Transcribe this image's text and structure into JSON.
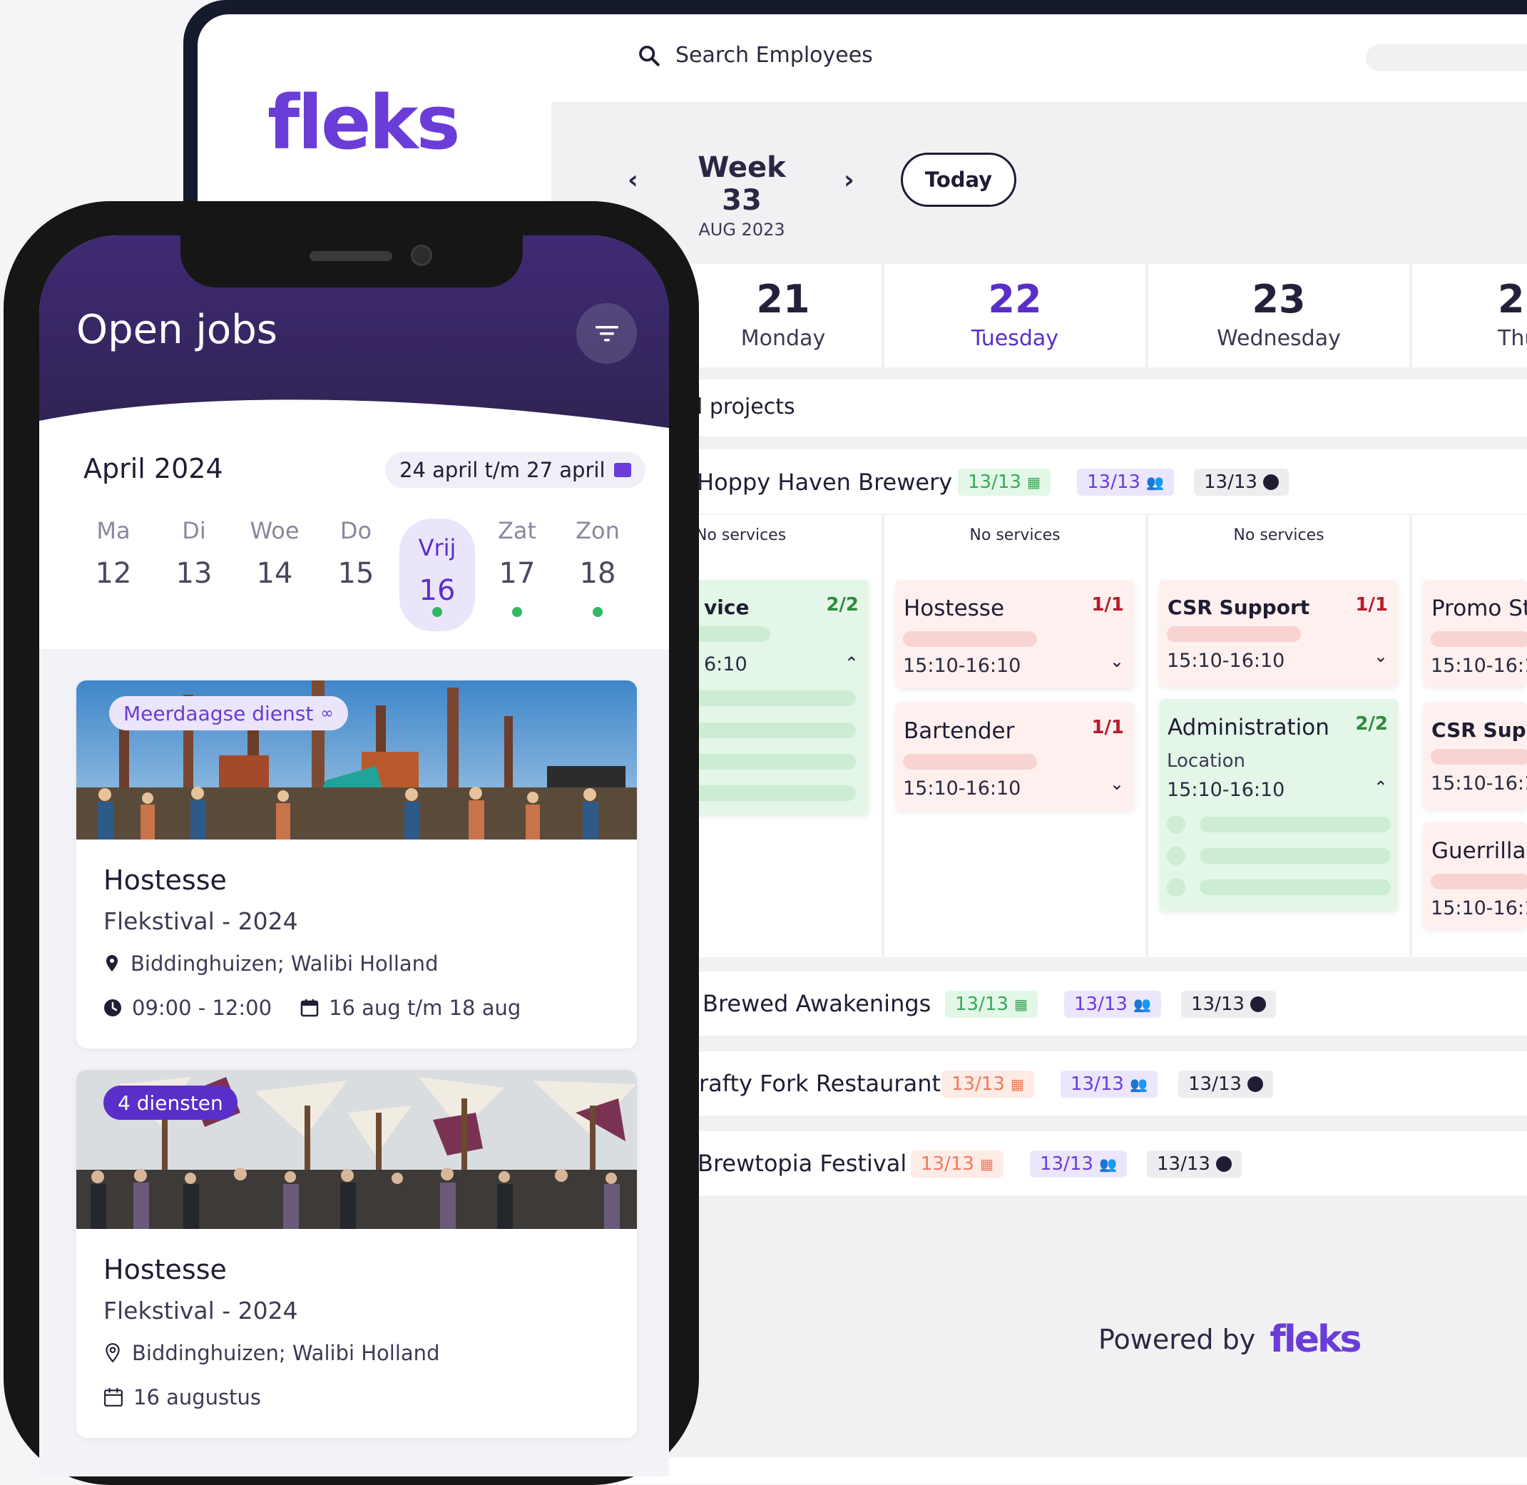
{
  "desktop": {
    "search_placeholder": "Search Employees",
    "logo_text": "fleks",
    "week_title": "Week 33",
    "week_subtitle": "AUG 2023",
    "prev_icon": "chevron-left-icon",
    "next_icon": "chevron-right-icon",
    "today_label": "Today",
    "days": [
      {
        "num": "21",
        "name": "Monday"
      },
      {
        "num": "22",
        "name": "Tuesday"
      },
      {
        "num": "23",
        "name": "Wednesday"
      },
      {
        "num": "2",
        "name": "Thu"
      }
    ],
    "section_label": "l projects",
    "no_services": "No services",
    "projects": [
      {
        "name": "Hoppy Haven Brewery",
        "b1": "13/13",
        "b2": "13/13",
        "b3": "13/13"
      },
      {
        "name": "Brewed Awakenings",
        "b1": "13/13",
        "b2": "13/13",
        "b3": "13/13"
      },
      {
        "name": "rafty Fork Restaurant",
        "b1": "13/13",
        "b2": "13/13",
        "b3": "13/13"
      },
      {
        "name": "Brewtopia Festival",
        "b1": "13/13",
        "b2": "13/13",
        "b3": "13/13"
      }
    ],
    "cards": {
      "mon": {
        "title": "vice",
        "frac": "2/2",
        "time": "6:10"
      },
      "tue1": {
        "title": "Hostesse",
        "frac": "1/1",
        "time": "15:10-16:10"
      },
      "tue2": {
        "title": "Bartender",
        "frac": "1/1",
        "time": "15:10-16:10"
      },
      "wed1": {
        "title": "CSR Support",
        "frac": "1/1",
        "time": "15:10-16:10"
      },
      "wed2": {
        "title": "Administration",
        "frac": "2/2",
        "location": "Location",
        "time": "15:10-16:10"
      },
      "thu1": {
        "title": "Promo St",
        "time": "15:10-16:1"
      },
      "thu2": {
        "title": "CSR Suppo",
        "time": "15:10-16:1"
      },
      "thu3": {
        "title": "Guerrilla",
        "time": "15:10-16:1"
      }
    },
    "powered_by": "Powered by",
    "powered_logo": "fleks"
  },
  "phone": {
    "header_title": "Open jobs",
    "filter_icon": "filter-icon",
    "month": "April 2024",
    "range": "24 april t/m 27 april",
    "weekdays": [
      {
        "label": "Ma",
        "day": "12"
      },
      {
        "label": "Di",
        "day": "13"
      },
      {
        "label": "Woe",
        "day": "14"
      },
      {
        "label": "Do",
        "day": "15"
      },
      {
        "label": "Vrij",
        "day": "16"
      },
      {
        "label": "Zat",
        "day": "17"
      },
      {
        "label": "Zon",
        "day": "18"
      }
    ],
    "jobs": [
      {
        "badge": "Meerdaagse dienst",
        "title": "Hostesse",
        "event": "Flekstival - 2024",
        "location": "Biddinghuizen; Walibi Holland",
        "time": "09:00 - 12:00",
        "dates": "16 aug t/m 18 aug"
      },
      {
        "badge": "4 diensten",
        "title": "Hostesse",
        "event": "Flekstival - 2024",
        "location": "Biddinghuizen; Walibi Holland",
        "dates": "16 augustus"
      }
    ]
  },
  "colors": {
    "brand_purple": "#6a3cd8",
    "header_purple": "#3f2a74",
    "success_green": "#2fba62",
    "alert_red": "#b7192b"
  }
}
